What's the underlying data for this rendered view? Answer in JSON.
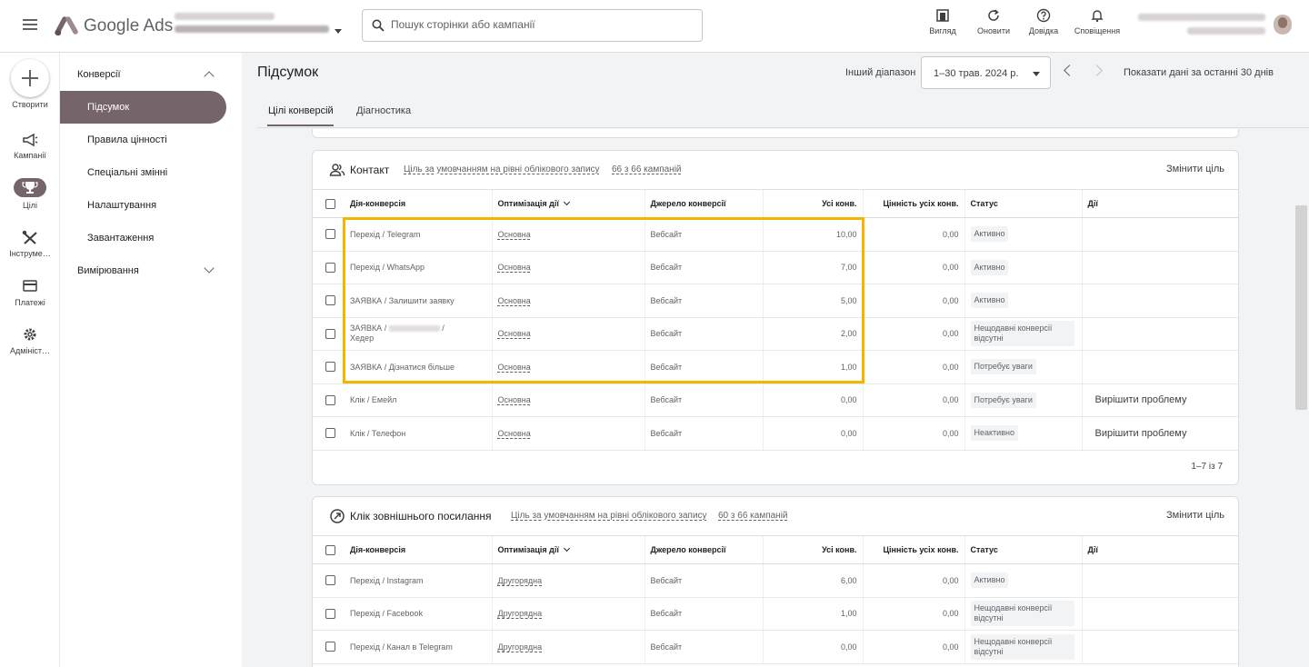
{
  "header": {
    "app_name": "Google Ads",
    "search_placeholder": "Пошук сторінки або кампанії",
    "tools": {
      "view": "Вигляд",
      "refresh": "Оновити",
      "help": "Довідка",
      "notifications": "Сповіщення"
    }
  },
  "rail": {
    "create": "Створити",
    "campaigns": "Кампанії",
    "goals": "Цілі",
    "tools": "Інструме…",
    "billing": "Платежі",
    "admin": "Адмініст…"
  },
  "subnav": {
    "conversions": "Конверсії",
    "summary": "Підсумок",
    "value_rules": "Правила цінності",
    "custom_variables": "Спеціальні змінні",
    "settings": "Налаштування",
    "uploads": "Завантаження",
    "measurement": "Вимірювання"
  },
  "main": {
    "title": "Підсумок",
    "range_label": "Інший діапазон",
    "range_value": "1–30 трав. 2024 р.",
    "show_last_30": "Показати дані за останні 30 днів",
    "tabs": [
      "Цілі конверсій",
      "Діагностика"
    ]
  },
  "columns": [
    "Дія-конверсія",
    "Оптимізація дії",
    "Джерело конверсії",
    "Усі конв.",
    "Цінність усіх конв.",
    "Статус",
    "Дії"
  ],
  "contact_card": {
    "title": "Контакт",
    "default_goal": "Ціль за умовчанням на рівні облікового запису",
    "campaigns": "66 з 66 кампаній",
    "change_goal": "Змінити ціль",
    "pagination": "1–7 із 7",
    "rows": [
      {
        "name": "Перехід / Telegram",
        "opt": "Основна",
        "source": "Вебсайт",
        "conv": "10,00",
        "value": "0,00",
        "status": "Активно",
        "action": ""
      },
      {
        "name": "Перехід / WhatsApp",
        "opt": "Основна",
        "source": "Вебсайт",
        "conv": "7,00",
        "value": "0,00",
        "status": "Активно",
        "action": ""
      },
      {
        "name": "ЗАЯВКА / Залишити заявку",
        "opt": "Основна",
        "source": "Вебсайт",
        "conv": "5,00",
        "value": "0,00",
        "status": "Активно",
        "action": ""
      },
      {
        "name_a": "ЗАЯВКА /",
        "name_b": "/",
        "name_c": "Хедер",
        "opt": "Основна",
        "source": "Вебсайт",
        "conv": "2,00",
        "value": "0,00",
        "status": "Нещодавні конверсії відсутні",
        "action": ""
      },
      {
        "name": "ЗАЯВКА / Дізнатися більше",
        "opt": "Основна",
        "source": "Вебсайт",
        "conv": "1,00",
        "value": "0,00",
        "status": "Потребує уваги",
        "action": ""
      },
      {
        "name": "Клік / Емейл",
        "opt": "Основна",
        "source": "Вебсайт",
        "conv": "0,00",
        "value": "0,00",
        "status": "Потребує уваги",
        "action": "Вирішити проблему"
      },
      {
        "name": "Клік / Телефон",
        "opt": "Основна",
        "source": "Вебсайт",
        "conv": "0,00",
        "value": "0,00",
        "status": "Неактивно",
        "action": "Вирішити проблему"
      }
    ]
  },
  "outbound_card": {
    "title": "Клік зовнішнього посилання",
    "default_goal": "Ціль за умовчанням на рівні облікового запису",
    "campaigns": "60 з 66 кампаній",
    "change_goal": "Змінити ціль",
    "rows": [
      {
        "name": "Перехід / Instagram",
        "opt": "Другорядна",
        "source": "Вебсайт",
        "conv": "6,00",
        "value": "0,00",
        "status": "Активно"
      },
      {
        "name": "Перехід / Facebook",
        "opt": "Другорядна",
        "source": "Вебсайт",
        "conv": "1,00",
        "value": "0,00",
        "status": "Нещодавні конверсії відсутні"
      },
      {
        "name": "Перехід / Канал в Telegram",
        "opt": "Другорядна",
        "source": "Вебсайт",
        "conv": "0,00",
        "value": "0,00",
        "status": "Нещодавні конверсії відсутні"
      }
    ]
  },
  "colors": {
    "accent": "#75646a",
    "highlight": "#f4b400",
    "background": "#f1f3f4"
  },
  "icons": [
    "menu-icon",
    "google-ads-logo",
    "search-icon",
    "view-icon",
    "refresh-icon",
    "help-icon",
    "bell-icon",
    "plus-icon",
    "megaphone-icon",
    "trophy-icon",
    "wrench-icon",
    "card-icon",
    "gear-icon",
    "people-icon",
    "link-icon"
  ]
}
